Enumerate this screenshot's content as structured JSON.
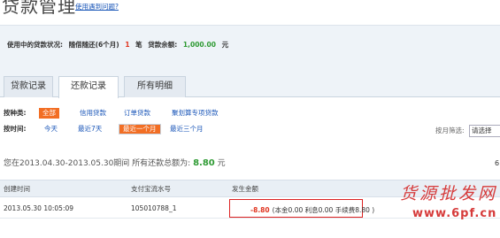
{
  "header": {
    "title": "贷款管理",
    "help_link": "使用遇到问题?"
  },
  "status": {
    "label": "使用中的贷款状况:",
    "loan_type": "随借随还(6个月)",
    "count": "1",
    "count_unit": "笔",
    "balance_label": "贷款余额:",
    "balance_value": "1,000.00",
    "balance_unit": "元"
  },
  "tabs": [
    {
      "label": "贷款记录",
      "active": false
    },
    {
      "label": "还款记录",
      "active": true
    },
    {
      "label": "所有明细",
      "active": false
    }
  ],
  "filters": {
    "type_label": "按种类:",
    "type_options": [
      "全部",
      "信用贷款",
      "订单贷款",
      "聚划算专项贷款"
    ],
    "type_selected": "全部",
    "time_label": "按时间:",
    "time_options": [
      "今天",
      "最近7天",
      "最近一个月",
      "最近三个月"
    ],
    "time_selected": "最近一个月",
    "month_label": "按月筛选:",
    "month_placeholder": "请选择"
  },
  "summary": {
    "text": "您在2013.04.30-2013.05.30期间 所有还款总额为:",
    "amount": "8.80",
    "unit": "元",
    "edge_char": "6"
  },
  "table": {
    "headers": [
      "创建时间",
      "支付宝流水号",
      "发生金额"
    ],
    "rows": [
      {
        "time": "2013.05.30 10:05:09",
        "serial": "105010788_1",
        "amount": "-8.80",
        "detail": "(本金0.00    利息0.00    手续费8.80 )"
      }
    ]
  },
  "watermark": {
    "cn": "货源批发网",
    "url": "www.6pf.cn"
  },
  "colors": {
    "accent": "#f26e24",
    "negative": "#e0331e",
    "positive": "#2e9a33",
    "link": "#1a56b8",
    "highlight_box": "#d22"
  }
}
